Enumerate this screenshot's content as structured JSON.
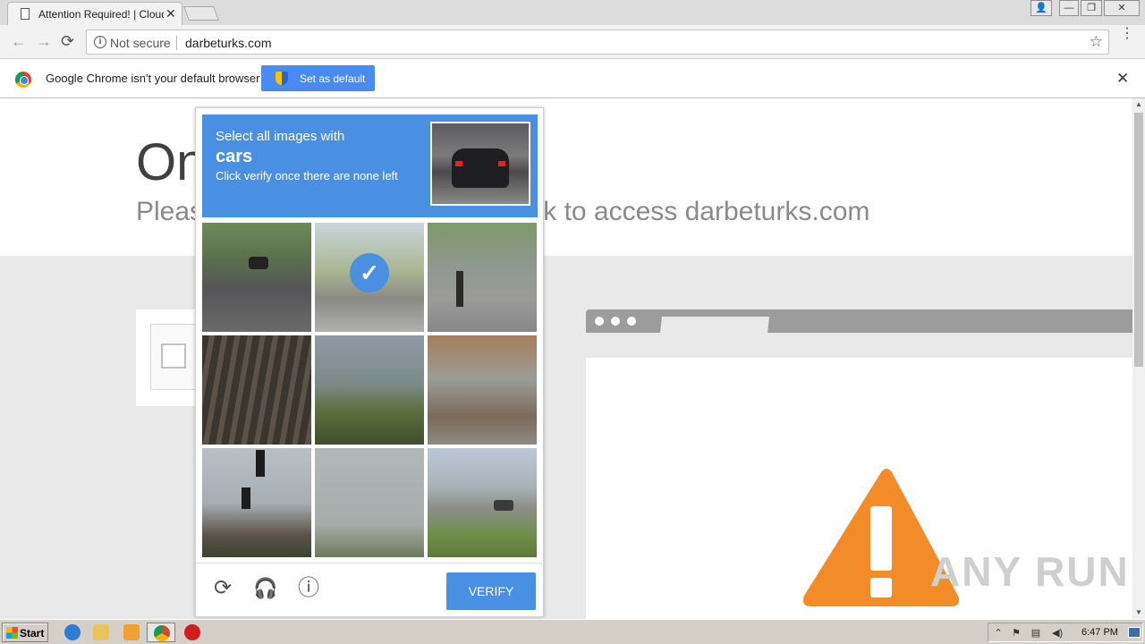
{
  "browser": {
    "tab_title": "Attention Required! | Cloudfl",
    "tab_close": "✕",
    "window_buttons": [
      "👤",
      "—",
      "❐",
      "✕"
    ],
    "nav": {
      "back": "←",
      "forward": "→",
      "reload": "⟳"
    },
    "address": {
      "security": "Not secure",
      "url": "darbeturks.com",
      "info_glyph": "i"
    },
    "bookmark_star": "☆",
    "menu": "⋮"
  },
  "infobar": {
    "message": "Google Chrome isn't your default browser",
    "button_label": "Set as default",
    "close": "✕"
  },
  "page": {
    "headline": "One more step",
    "subline": "Please complete the security check to access darbeturks.com",
    "watermark": "ANY RUN"
  },
  "captcha": {
    "instruction": "Select all images with",
    "target_word": "cars",
    "hint": "Click verify once there are none left",
    "tiles": [
      {
        "desc": "road with car",
        "selected": false
      },
      {
        "desc": "road with white car",
        "selected": true
      },
      {
        "desc": "street with cyclist",
        "selected": false
      },
      {
        "desc": "underside of bridge",
        "selected": false
      },
      {
        "desc": "trees and sky",
        "selected": false
      },
      {
        "desc": "sidewalk construction",
        "selected": false
      },
      {
        "desc": "traffic lights",
        "selected": false
      },
      {
        "desc": "grey sky",
        "selected": false
      },
      {
        "desc": "parking lot with cars",
        "selected": false
      }
    ],
    "check_glyph": "✓",
    "footer": {
      "reload": "⟳",
      "audio": "🎧",
      "info": "ⓘ",
      "verify": "VERIFY"
    },
    "accent": "#4a90e2"
  },
  "taskbar": {
    "start": "Start",
    "clock": "6:47 PM",
    "tray_expand": "⌃"
  },
  "colors": {
    "warning": "#f28c28",
    "infobar_button": "#4a8af4"
  }
}
